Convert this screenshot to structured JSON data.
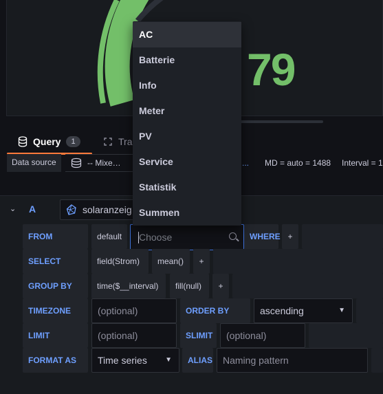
{
  "stat": {
    "value": "79"
  },
  "tabs": [
    {
      "label": "Query",
      "count": "1"
    },
    {
      "label": "Tra"
    }
  ],
  "datasource": {
    "label": "Data source",
    "value": "-- Mixe…",
    "dots": "...",
    "md": "MD = auto = 1488",
    "interval": "Interval = 1"
  },
  "query": {
    "letter": "A",
    "datasource": "solaranzeig"
  },
  "editor": {
    "from_kw": "FROM",
    "from_policy": "default",
    "measurement_placeholder": "Choose",
    "where_kw": "WHERE",
    "plus": "+",
    "select_kw": "SELECT",
    "select_field": "field(Strom)",
    "select_fn": "mean()",
    "groupby_kw": "GROUP BY",
    "groupby_time": "time($__interval)",
    "groupby_fill": "fill(null)",
    "timezone_kw": "TIMEZONE",
    "timezone_placeholder": "(optional)",
    "orderby_kw": "ORDER BY TIME",
    "orderby_value": "ascending",
    "limit_kw": "LIMIT",
    "limit_placeholder": "(optional)",
    "slimit_kw": "SLIMIT",
    "slimit_placeholder": "(optional)",
    "format_kw": "FORMAT AS",
    "format_value": "Time series",
    "alias_kw": "ALIAS",
    "alias_placeholder": "Naming pattern"
  },
  "dropdown": {
    "items": [
      "AC",
      "Batterie",
      "Info",
      "Meter",
      "PV",
      "Service",
      "Statistik",
      "Summen"
    ],
    "active_index": 0
  },
  "colors": {
    "gauge_green": "#73bf69",
    "accent_orange": "#ff7a3b",
    "keyword_blue": "#6e9fff",
    "focus_blue": "#3d71d9"
  }
}
